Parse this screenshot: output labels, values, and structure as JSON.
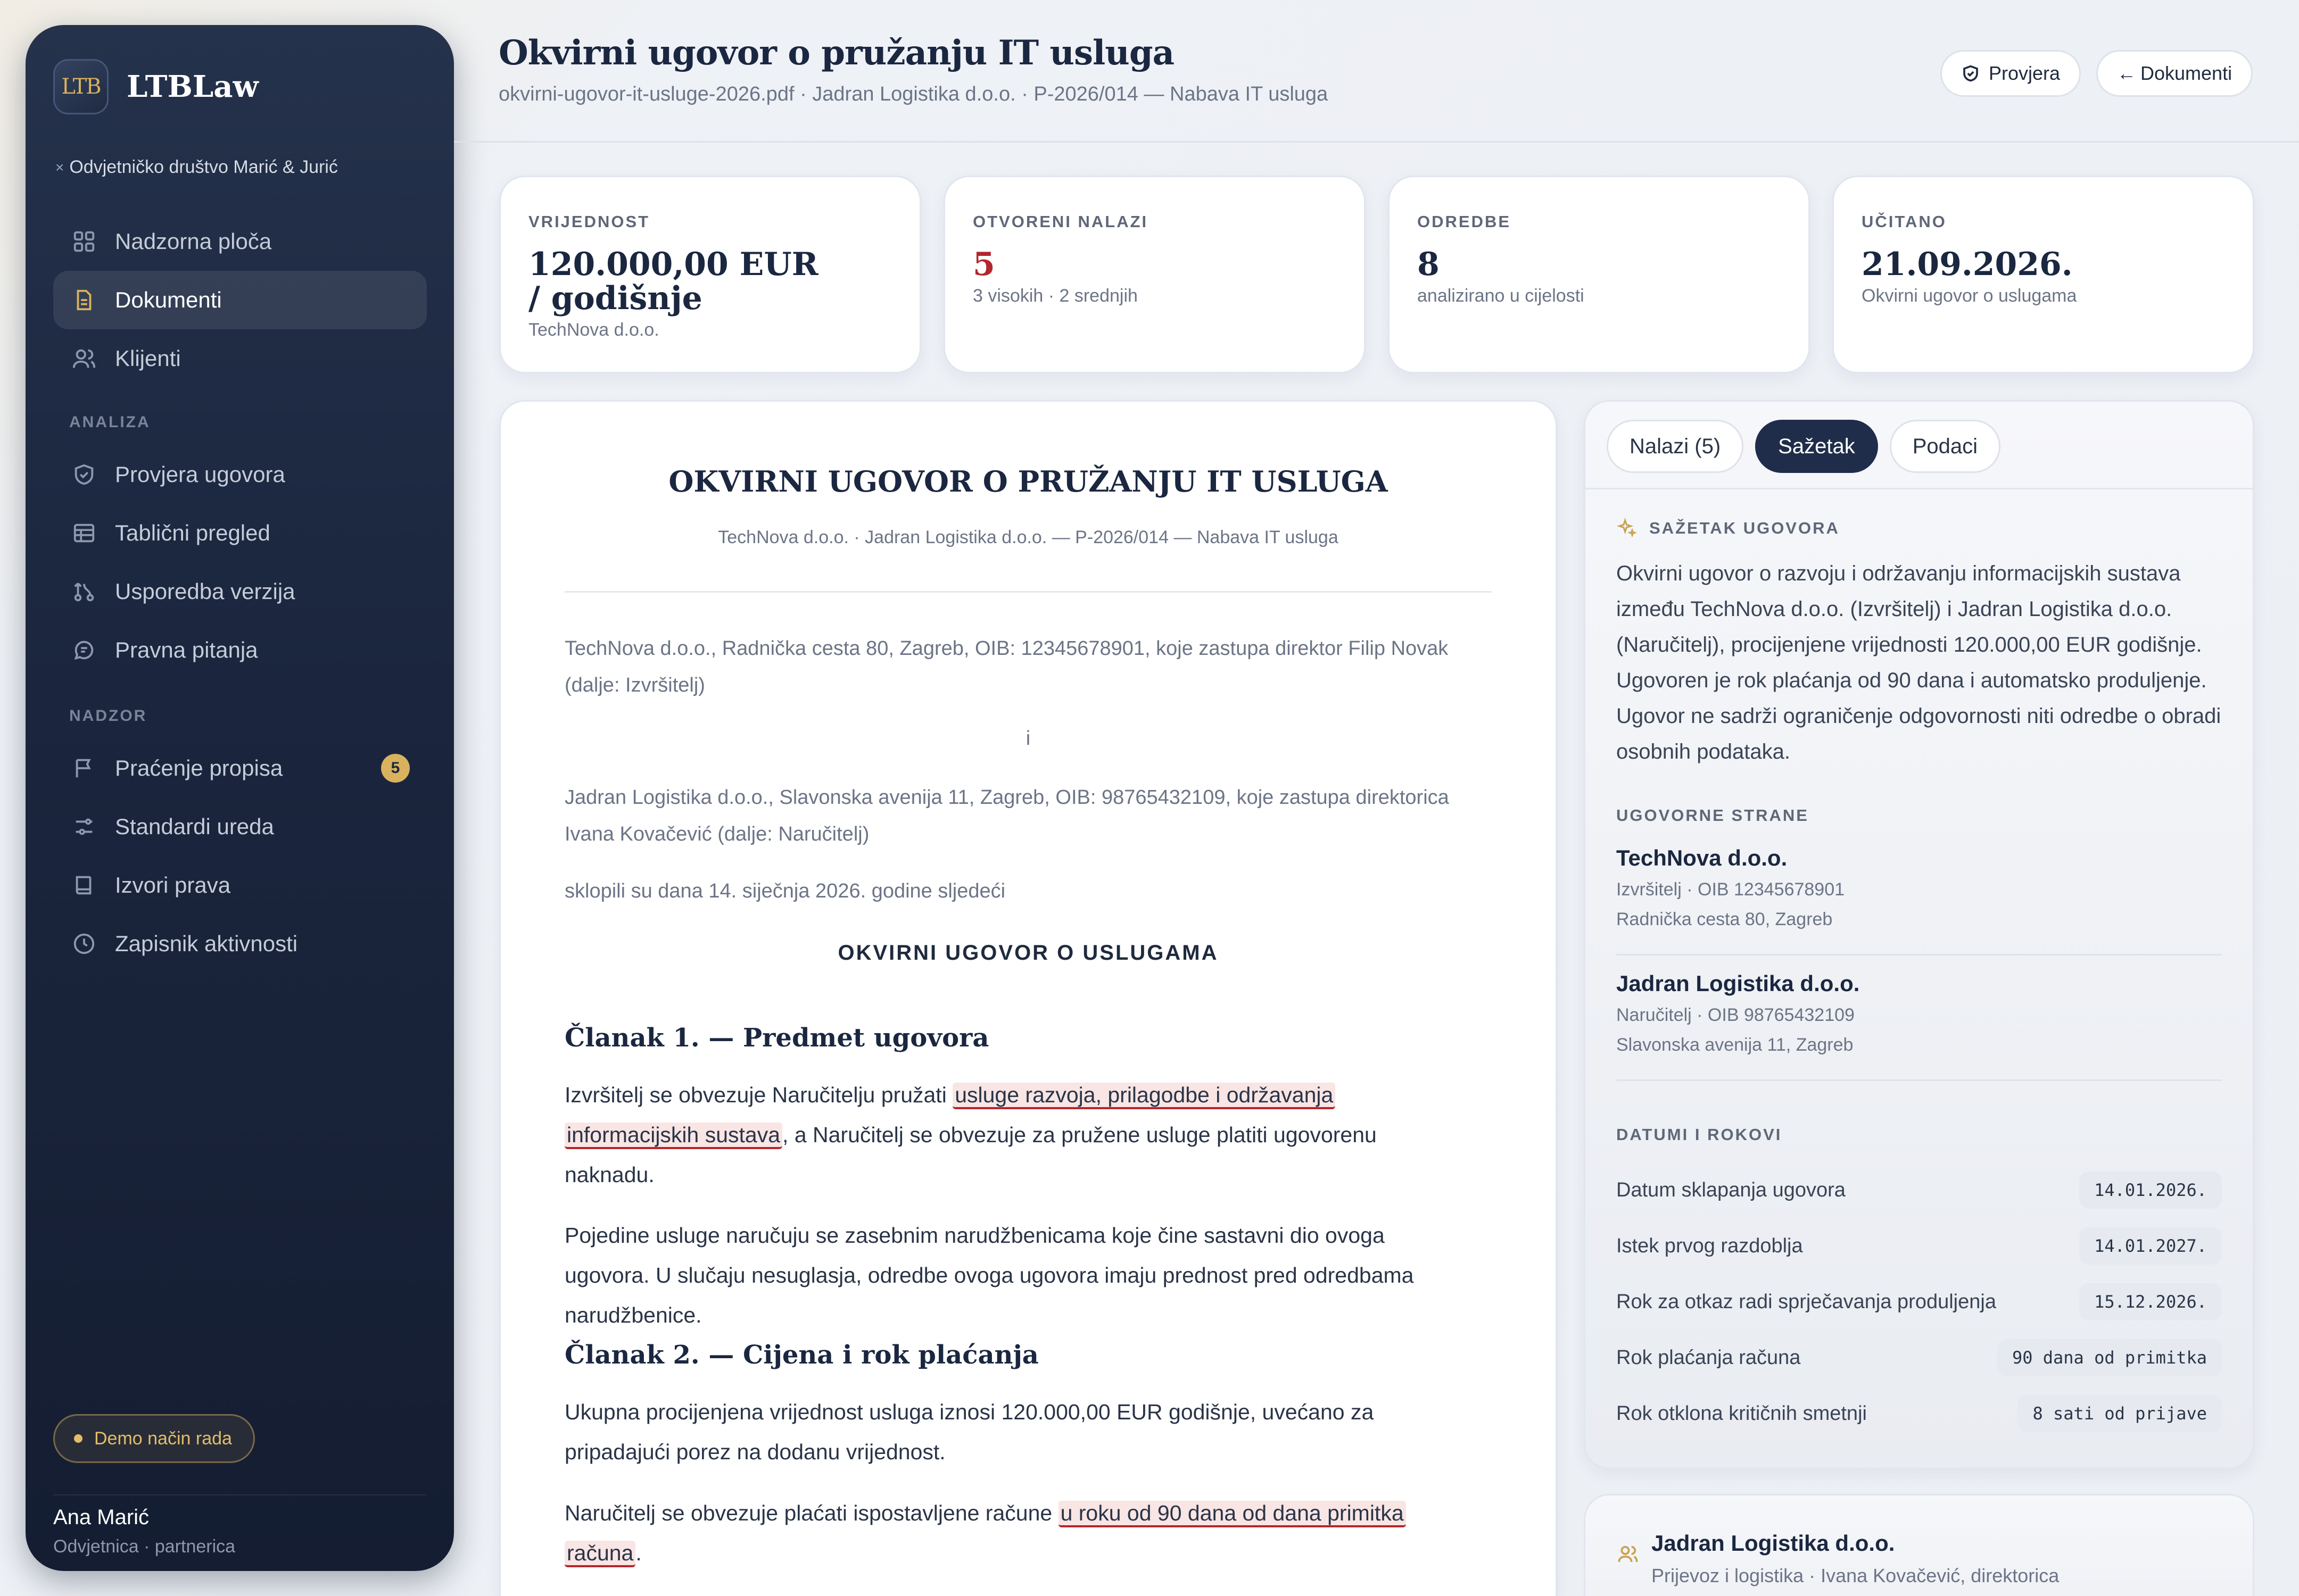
{
  "sidebar": {
    "logo_text": "LTB",
    "brand": "LTBLaw",
    "firm": "Odvjetničko društvo Marić & Jurić",
    "nav": [
      {
        "label": "Nadzorna ploča",
        "icon": "grid-icon"
      },
      {
        "label": "Dokumenti",
        "icon": "document-icon",
        "active": true
      },
      {
        "label": "Klijenti",
        "icon": "users-icon"
      }
    ],
    "section_analiza": "ANALIZA",
    "analiza": [
      {
        "label": "Provjera ugovora",
        "icon": "shield-icon"
      },
      {
        "label": "Tablični pregled",
        "icon": "table-icon"
      },
      {
        "label": "Usporedba verzija",
        "icon": "compare-icon"
      },
      {
        "label": "Pravna pitanja",
        "icon": "chat-icon"
      }
    ],
    "section_nadzor": "NADZOR",
    "nadzor": [
      {
        "label": "Praćenje propisa",
        "icon": "flag-icon",
        "badge": "5"
      },
      {
        "label": "Standardi ureda",
        "icon": "sliders-icon"
      },
      {
        "label": "Izvori prava",
        "icon": "book-icon"
      },
      {
        "label": "Zapisnik aktivnosti",
        "icon": "clock-icon"
      }
    ],
    "demo": "Demo način rada",
    "user_name": "Ana Marić",
    "user_role": "Odvjetnica · partnerica"
  },
  "header": {
    "title": "Okvirni ugovor o pružanju IT usluga",
    "subtitle": "okvirni-ugovor-it-usluge-2026.pdf · Jadran Logistika d.o.o. · P-2026/014 — Nabava IT usluga",
    "check_label": "Provjera",
    "back_label": "Dokumenti",
    "back_arrow": "←"
  },
  "stats": [
    {
      "label": "VRIJEDNOST",
      "value": "120.000,00 EUR / godišnje",
      "sub": "TechNova d.o.o."
    },
    {
      "label": "OTVORENI NALAZI",
      "value": "5",
      "sub": "3 visokih · 2 srednjih"
    },
    {
      "label": "ODREDBE",
      "value": "8",
      "sub": "analizirano u cijelosti"
    },
    {
      "label": "UČITANO",
      "value": "21.09.2026.",
      "sub": "Okvirni ugovor o uslugama"
    }
  ],
  "document": {
    "title": "OKVIRNI UGOVOR O PRUŽANJU IT USLUGA",
    "subtitle": "TechNova d.o.o. · Jadran Logistika d.o.o. — P-2026/014 — Nabava IT usluga",
    "party1": "TechNova d.o.o., Radnička cesta 80, Zagreb, OIB: 12345678901, koje zastupa direktor Filip Novak (dalje: Izvršitelj)",
    "and": "i",
    "party2": "Jadran Logistika d.o.o., Slavonska avenija 11, Zagreb, OIB: 98765432109, koje zastupa direktorica Ivana Kovačević (dalje: Naručitelj)",
    "concluded": "sklopili su dana 14. siječnja 2026. godine sljedeći",
    "heading": "OKVIRNI UGOVOR O USLUGAMA",
    "art1_title": "Članak 1. — Predmet ugovora",
    "art1_p1_a": "Izvršitelj se obvezuje Naručitelju pružati ",
    "art1_p1_hl1": "usluge razvoja, prilagodbe i održavanja",
    "art1_p1_hl2": "informacijskih sustava",
    "art1_p1_b": ", a Naručitelj se obvezuje za pružene usluge platiti ugovorenu naknadu.",
    "art1_p2": "Pojedine usluge naručuju se zasebnim narudžbenicama koje čine sastavni dio ovoga ugovora. U slučaju nesuglasja, odredbe ovoga ugovora imaju prednost pred odredbama narudžbenice.",
    "art2_title": "Članak 2. — Cijena i rok plaćanja",
    "art2_p1": "Ukupna procijenjena vrijednost usluga iznosi 120.000,00 EUR godišnje, uvećano za pripadajući porez na dodanu vrijednost.",
    "art2_p2_a": "Naručitelj se obvezuje plaćati ispostavljene račune ",
    "art2_p2_hl1": "u roku od 90 dana od dana primitka",
    "art2_p2_hl2": "računa",
    "art2_p2_b": "."
  },
  "panel": {
    "tabs": [
      "Nalazi (5)",
      "Sažetak",
      "Podaci"
    ],
    "active_tab": "Sažetak",
    "summary_heading": "SAŽETAK UGOVORA",
    "summary": "Okvirni ugovor o razvoju i održavanju informacijskih sustava između TechNova d.o.o. (Izvršitelj) i Jadran Logistika d.o.o. (Naručitelj), procijenjene vrijednosti 120.000,00 EUR godišnje. Ugovoren je rok plaćanja od 90 dana i automatsko produljenje. Ugovor ne sadrži ograničenje odgovornosti niti odredbe o obradi osobnih podataka.",
    "parties_heading": "UGOVORNE STRANE",
    "parties": [
      {
        "name": "TechNova d.o.o.",
        "line1": "Izvršitelj · OIB 12345678901",
        "line2": "Radnička cesta 80, Zagreb"
      },
      {
        "name": "Jadran Logistika d.o.o.",
        "line1": "Naručitelj · OIB 98765432109",
        "line2": "Slavonska avenija 11, Zagreb"
      }
    ],
    "dates_heading": "DATUMI I ROKOVI",
    "dates": [
      {
        "label": "Datum sklapanja ugovora",
        "value": "14.01.2026."
      },
      {
        "label": "Istek prvog razdoblja",
        "value": "14.01.2027."
      },
      {
        "label": "Rok za otkaz radi sprječavanja produljenja",
        "value": "15.12.2026."
      },
      {
        "label": "Rok plaćanja računa",
        "value": "90 dana od primitka"
      },
      {
        "label": "Rok otklona kritičnih smetnji",
        "value": "8 sati od prijave"
      }
    ]
  },
  "client": {
    "name": "Jadran Logistika d.o.o.",
    "sub": "Prijevoz i logistika · Ivana Kovačević, direktorica"
  },
  "colors": {
    "accent": "#d9b25e",
    "navy": "#1f2d4a",
    "danger": "#b3262b"
  }
}
